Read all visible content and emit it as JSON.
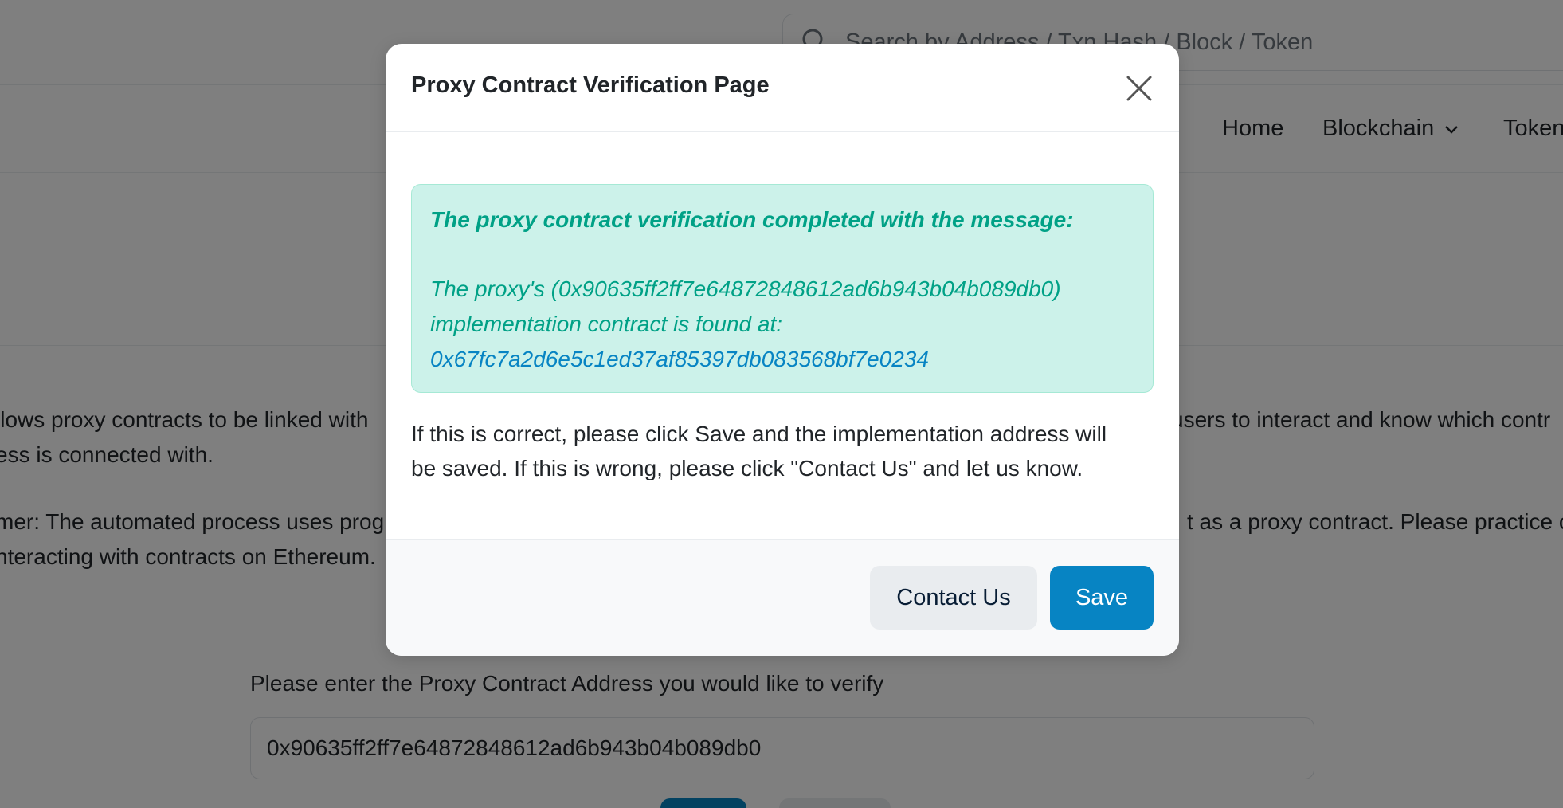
{
  "header": {
    "search_placeholder": "Search by Address / Txn Hash / Block / Token"
  },
  "nav": {
    "home": "Home",
    "blockchain": "Blockchain",
    "tokens": "Token"
  },
  "background": {
    "para1_left": "llows proxy contracts to be linked with",
    "para1_right": "users to interact and know which contr",
    "para1_line2": "ess is connected with.",
    "para2_left": "mer: The automated process uses prog",
    "para2_right": "t as a proxy contract. Please practice c",
    "para2_line2": "nteracting with contracts on Ethereum.",
    "form_label": "Please enter the Proxy Contract Address you would like to verify",
    "form_value": "0x90635ff2ff7e64872848612ad6b943b04b089db0"
  },
  "modal": {
    "title": "Proxy Contract Verification Page",
    "alert_heading": "The proxy contract verification completed with the message:",
    "alert_line1": "The proxy's (0x90635ff2ff7e64872848612ad6b943b04b089db0)",
    "alert_line2": "implementation contract is found at:",
    "implementation_address": "0x67fc7a2d6e5c1ed37af85397db083568bf7e0234",
    "body_line1": "If this is correct, please click Save and the implementation address will",
    "body_line2": "be saved. If this is wrong, please click \"Contact Us\" and let us know.",
    "contact_label": "Contact Us",
    "save_label": "Save"
  },
  "icons": {
    "search": "search-icon",
    "close": "close-icon",
    "chevron": "chevron-down-icon"
  },
  "colors": {
    "primary": "#0784c3",
    "success_text": "#00a186",
    "success_bg": "#ccf2ea",
    "backdrop": "rgba(0,0,0,0.5)"
  }
}
